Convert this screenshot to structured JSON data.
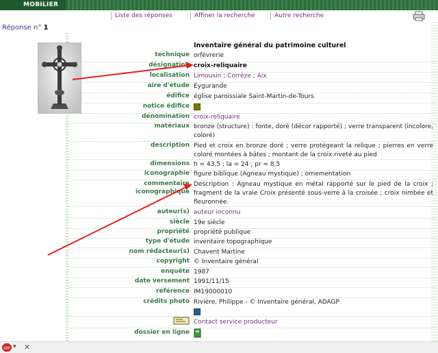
{
  "header": {
    "section_tab": "MOBILIER",
    "nav": [
      {
        "label": "Liste des réponses"
      },
      {
        "label": "Affiner la recherche"
      },
      {
        "label": "Autre recherche"
      }
    ]
  },
  "result": {
    "label": "Réponse n°",
    "number": "1"
  },
  "record": {
    "title": "Inventaire général du patrimoine culturel",
    "technique": {
      "label": "technique",
      "value": "orfèvrerie"
    },
    "designation": {
      "label": "désignation",
      "value": "croix-reliquaire"
    },
    "localisation": {
      "label": "localisation",
      "parts": [
        "Limousin",
        "Corrèze",
        "Aix"
      ],
      "sep": " ; "
    },
    "aire": {
      "label": "aire d'étude",
      "value": "Eygurande"
    },
    "edifice": {
      "label": "édifice",
      "value": "église paroissiale Saint-Martin-de-Tours"
    },
    "notice": {
      "label": "notice édifice"
    },
    "denomination": {
      "label": "dénomination",
      "value": "croix-reliquaire"
    },
    "materiaux": {
      "label": "matériaux",
      "value": "bronze (structure) : fonte, doré (décor rapporté) ; verre transparent (incolore, coloré)"
    },
    "description": {
      "label": "description",
      "value": "Pied et croix en bronze doré ; verre protégeant la relique ; pierres en verre coloré montées à bâtes ; montant de la croix riveté au pied"
    },
    "dimensions": {
      "label": "dimensions",
      "value": "h = 43,5 ; la = 24 ; pr = 8,5"
    },
    "iconographie": {
      "label": "iconographie",
      "value": "figure biblique (Agneau mystique) ; ornementation"
    },
    "commentaire": {
      "label1": "commentaire",
      "label2": "iconographique",
      "value": "Description : Agneau mystique en métal rapporté sur le pied de la croix ; fragment de la vraie Croix présenté sous-verre à la croisée ; croix nimbée et fleuronnée."
    },
    "auteur": {
      "label": "auteur(s)",
      "value": "auteur inconnu"
    },
    "siecle": {
      "label": "siècle",
      "value": "19e siècle"
    },
    "propriete": {
      "label": "propriété",
      "value": "propriété publique"
    },
    "type_etude": {
      "label": "type d'étude",
      "value": "inventaire topographique"
    },
    "redacteur": {
      "label": "nom rédacteur(s)",
      "value": "Chavent Martine"
    },
    "copyright": {
      "label": "copyright",
      "value": "© Inventaire général"
    },
    "enquete": {
      "label": "enquête",
      "value": "1987"
    },
    "versement": {
      "label": "date versement",
      "value": "1991/11/15"
    },
    "reference": {
      "label": "référence",
      "value": "IM19000010"
    },
    "credits": {
      "label": "crédits photo",
      "value": "Rivière, Philippe - © Inventaire général, ADAGP"
    },
    "contact": {
      "value": "Contact service producteur"
    },
    "dossier": {
      "label": "dossier en ligne"
    }
  },
  "status_bar": {
    "addon_label": "ABP"
  },
  "colors": {
    "label_green": "#3b7a4a",
    "link_purple": "#7a2a83",
    "header_green": "#2f6b3c",
    "arrow_red": "#e0201b"
  }
}
